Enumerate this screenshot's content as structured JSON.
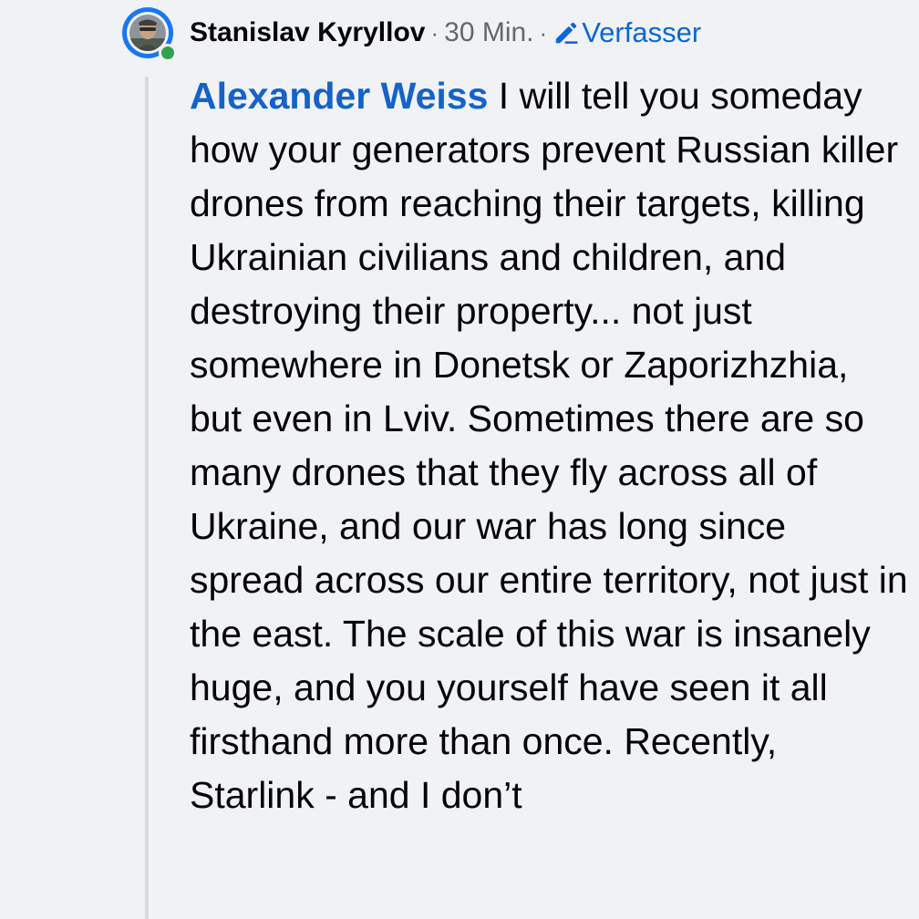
{
  "comment": {
    "author": "Stanislav Kyryllov",
    "separator": "·",
    "time": "30 Min.",
    "badge_icon": "pencil-icon",
    "badge_label": "Verfasser",
    "mention": "Alexander Weiss",
    "text": " I will tell you someday how your generators prevent Russian killer drones from reaching their targets, killing Ukrainian civilians and children, and destroying their property... not just somewhere in Donetsk or Zaporizhzhia, but even in Lviv. Sometimes there are so many drones that they fly across all of Ukraine, and our war has long since spread across our entire territory, not just in the east. The scale of this war is insanely huge, and you yourself have seen it all firsthand more than once. Recently, Starlink - and I don’t"
  },
  "colors": {
    "background": "#f0f2f5",
    "mention": "#1562c8",
    "badge": "#0a66d8",
    "online": "#31a24c",
    "avatar_ring": "#1877f2"
  }
}
